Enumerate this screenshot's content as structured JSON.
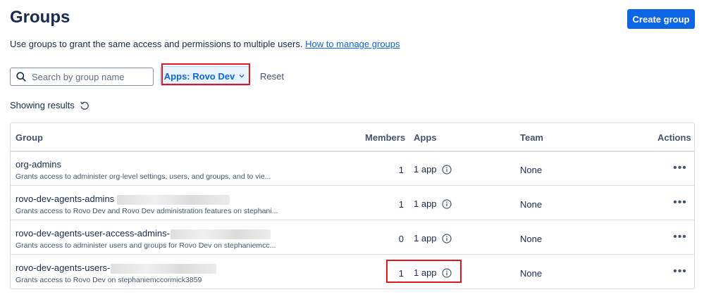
{
  "header": {
    "title": "Groups",
    "create_button": "Create group"
  },
  "intro": {
    "text": "Use groups to grant the same access and permissions to multiple users. ",
    "link": "How to manage groups"
  },
  "filters": {
    "search_placeholder": "Search by group name",
    "apps_filter": "Apps: Rovo Dev",
    "reset": "Reset"
  },
  "results": {
    "label": "Showing results"
  },
  "table": {
    "columns": {
      "group": "Group",
      "members": "Members",
      "apps": "Apps",
      "team": "Team",
      "actions": "Actions"
    },
    "rows": [
      {
        "name": "org-admins",
        "description": "Grants access to administer org-level settings, users, and groups, and to vie...",
        "members": "1",
        "apps": "1 app",
        "team": "None"
      },
      {
        "name": "rovo-dev-agents-admins",
        "description": "Grants access to Rovo Dev and Rovo Dev administration features on stephani...",
        "members": "1",
        "apps": "1 app",
        "team": "None"
      },
      {
        "name": "rovo-dev-agents-user-access-admins-",
        "description": "Grants access to administer users and groups for Rovo Dev on stephaniemcc...",
        "members": "0",
        "apps": "1 app",
        "team": "None"
      },
      {
        "name": "rovo-dev-agents-users-",
        "description": "Grants access to Rovo Dev on stephaniemccormick3859",
        "members": "1",
        "apps": "1 app",
        "team": "None"
      }
    ]
  },
  "colors": {
    "primary": "#0c66e4",
    "highlight": "#e4171e"
  }
}
